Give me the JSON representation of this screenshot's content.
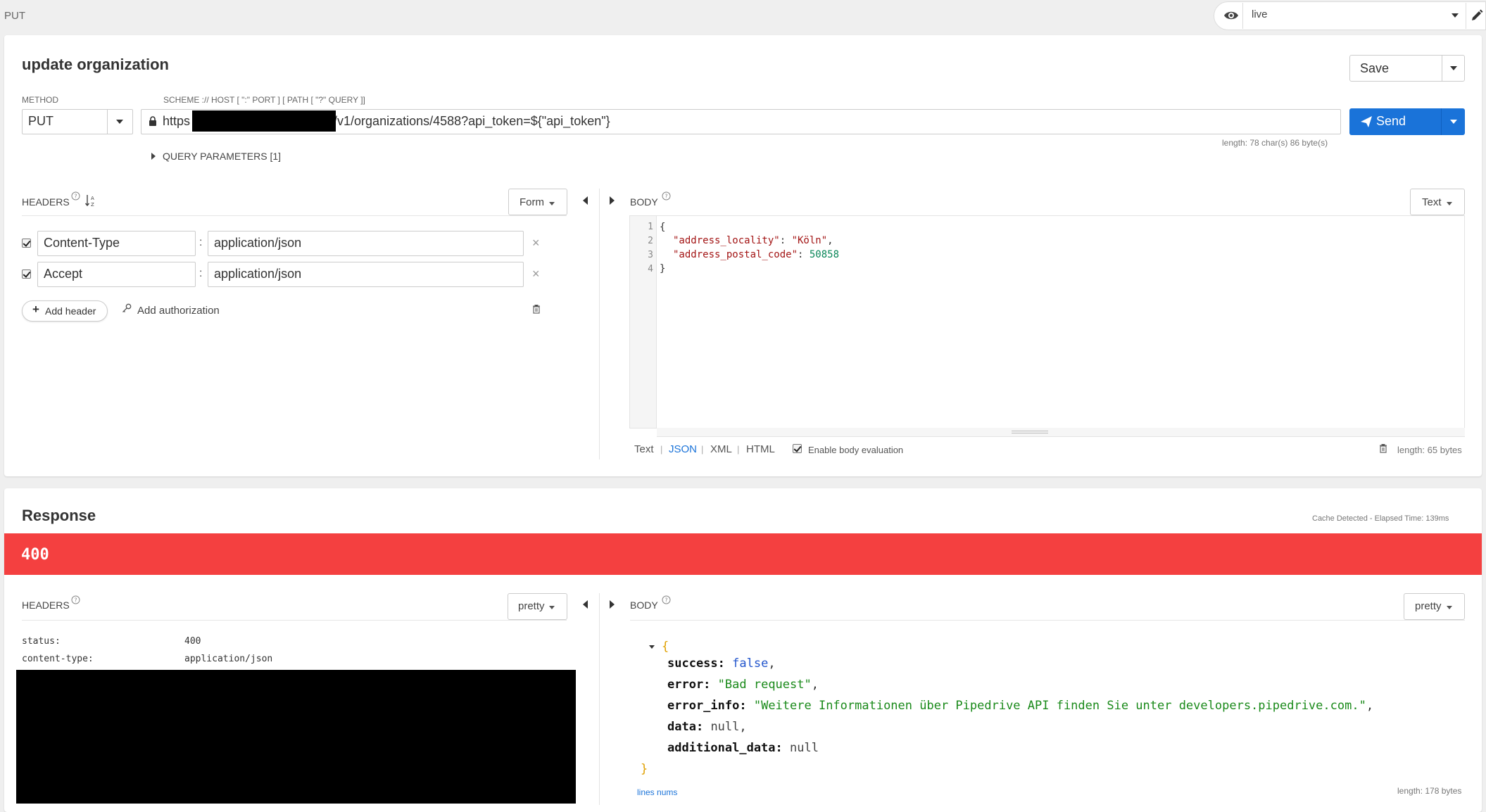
{
  "top": {
    "method": "PUT",
    "environment": "live"
  },
  "request": {
    "title": "update organization",
    "save_label": "Save",
    "method_label": "METHOD",
    "method_value": "PUT",
    "url_label": "SCHEME :// HOST [ \":\" PORT ] [ PATH [ \"?\" QUERY ]]",
    "url_scheme": "https",
    "url_rest": "/v1/organizations/4588?api_token=${\"api_token\"}",
    "url_length": "length: 78 char(s) 86 byte(s)",
    "send_label": "Send",
    "query_params_label": "QUERY PARAMETERS [1]",
    "headers_label": "HEADERS",
    "headers_mode": "Form",
    "headers": [
      {
        "name": "Content-Type",
        "value": "application/json"
      },
      {
        "name": "Accept",
        "value": "application/json"
      }
    ],
    "add_header_label": "Add header",
    "add_auth_label": "Add authorization",
    "body_label": "BODY",
    "body_mode": "Text",
    "body_lines": {
      "l1": "{",
      "l2_key": "\"address_locality\"",
      "l2_sep": ": ",
      "l2_val": "\"Köln\"",
      "l2_end": ",",
      "l3_key": "\"address_postal_code\"",
      "l3_sep": ": ",
      "l3_val": "50858",
      "l4": "}"
    },
    "line_numbers": [
      "1",
      "2",
      "3",
      "4"
    ],
    "body_formats": {
      "text": "Text",
      "json": "JSON",
      "xml": "XML",
      "html": "HTML"
    },
    "enable_eval_label": "Enable body evaluation",
    "body_length": "length: 65 bytes"
  },
  "response": {
    "title": "Response",
    "cache_info": "Cache Detected - Elapsed Time: 139ms",
    "status_code": "400",
    "headers_label": "HEADERS",
    "headers_mode": "pretty",
    "headers": [
      {
        "name": "status:",
        "value": "400"
      },
      {
        "name": "content-type:",
        "value": "application/json"
      }
    ],
    "body_label": "BODY",
    "body_mode": "pretty",
    "body": {
      "open": "{",
      "success_key": "success:",
      "success_val": "false",
      "error_key": "error:",
      "error_val": "\"Bad request\"",
      "error_info_key": "error_info:",
      "error_info_val": "\"Weitere Informationen über Pipedrive API finden Sie unter developers.pipedrive.com.\"",
      "data_key": "data:",
      "data_val": "null",
      "additional_key": "additional_data:",
      "additional_val": "null",
      "close": "}"
    },
    "lines_nums_label": "lines nums",
    "body_length": "length: 178 bytes"
  },
  "colors": {
    "status_bar": "#f44040",
    "send_button": "#1a73d9",
    "link": "#1a73d9"
  }
}
